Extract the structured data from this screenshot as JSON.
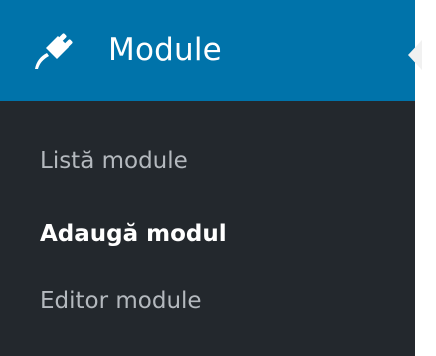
{
  "menu": {
    "title": "Module",
    "icon": "plugin-icon",
    "colors": {
      "header_bg": "#0073aa",
      "panel_bg": "#23282d",
      "text_active": "#ffffff",
      "text_muted": "#b4b9be"
    },
    "items": [
      {
        "label": "Listă module",
        "current": false
      },
      {
        "label": "Adaugă modul",
        "current": true
      },
      {
        "label": "Editor module",
        "current": false
      }
    ]
  }
}
